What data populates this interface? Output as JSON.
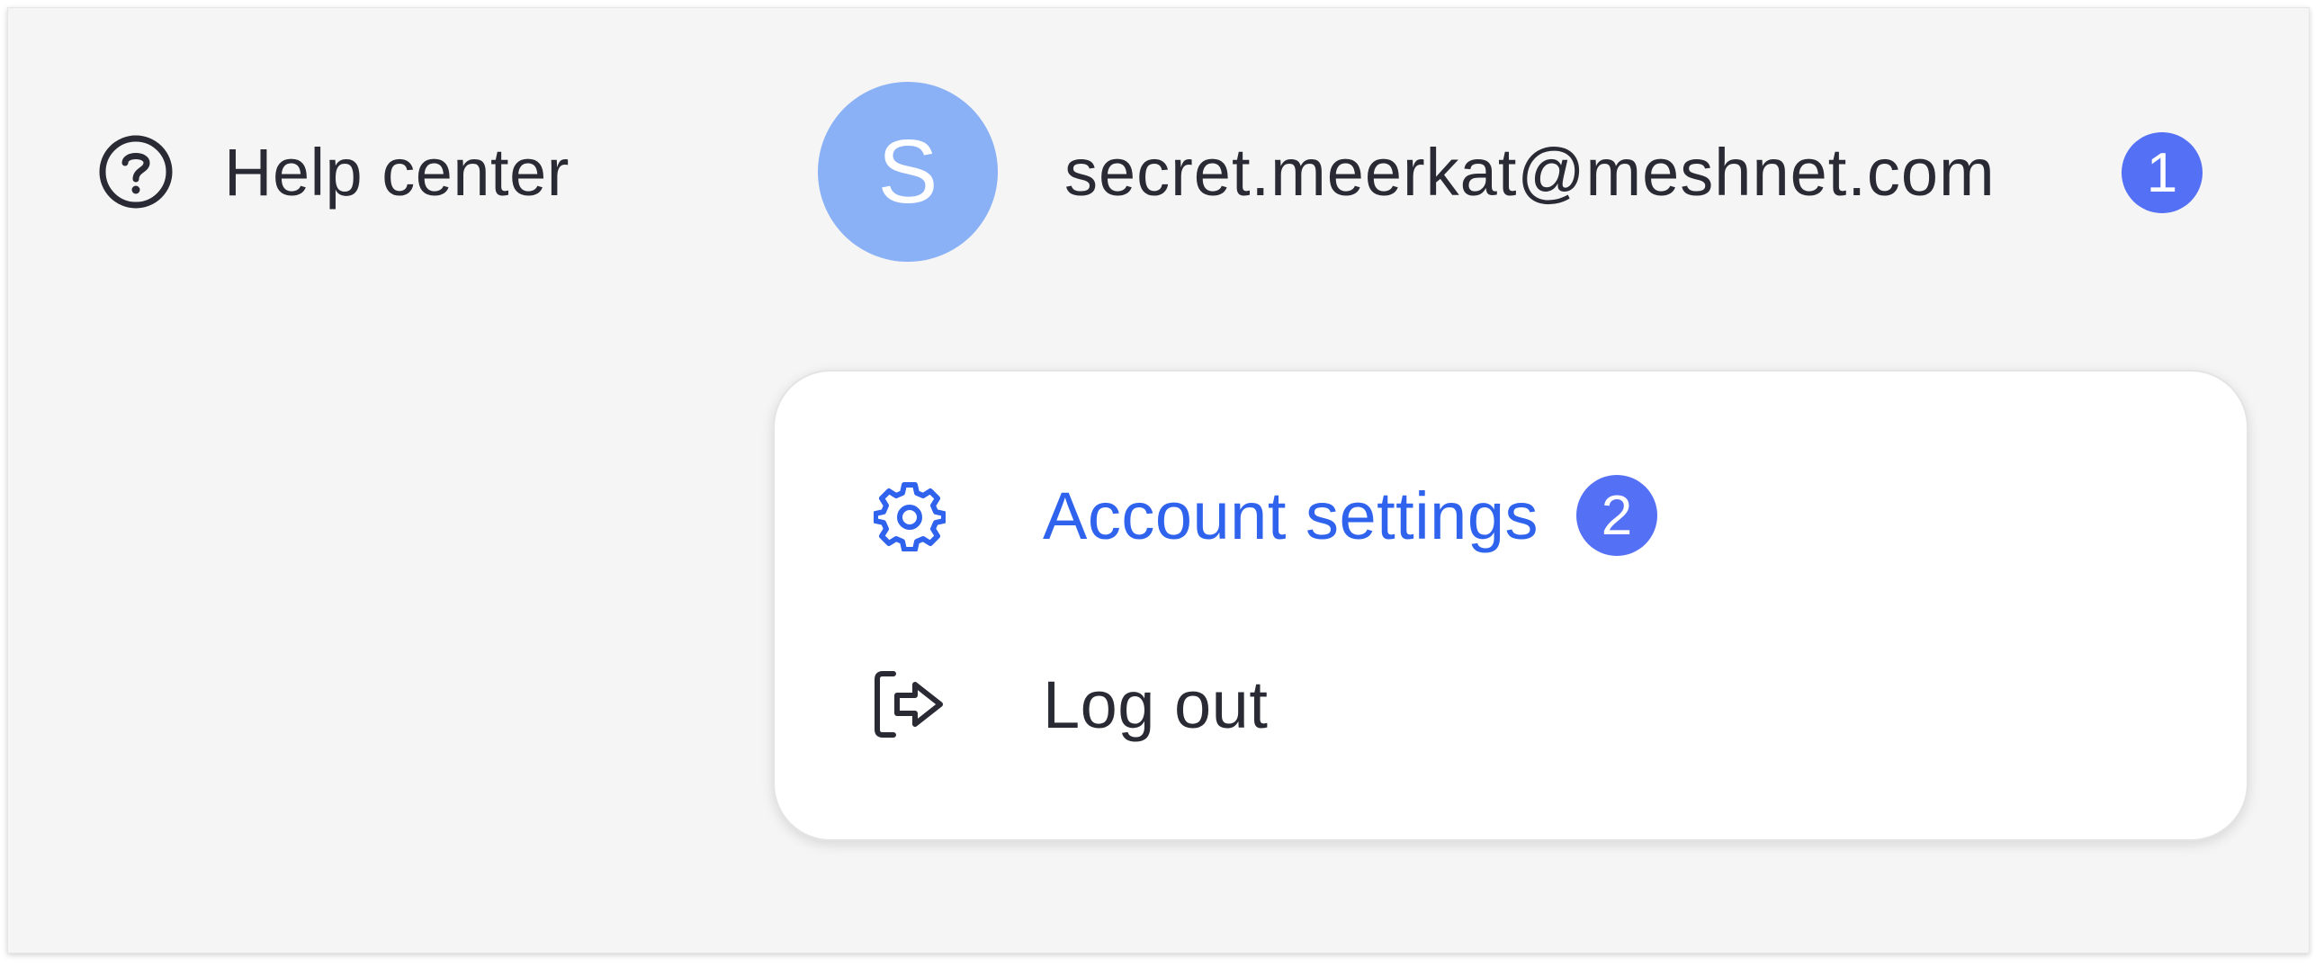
{
  "header": {
    "help": {
      "label": "Help center",
      "icon": "question-circle-icon"
    },
    "account": {
      "avatar_initial": "S",
      "email": "secret.meerkat@meshnet.com",
      "badge": "1"
    }
  },
  "menu": {
    "items": [
      {
        "label": "Account settings",
        "icon": "gear-icon",
        "badge": "2",
        "color": "#2f63ee"
      },
      {
        "label": "Log out",
        "icon": "logout-icon",
        "color": "#2a2a35"
      }
    ]
  },
  "colors": {
    "panel_bg": "#f5f5f5",
    "avatar_bg": "#8ab0f6",
    "badge_bg": "#5470f5",
    "accent": "#2f63ee",
    "text": "#2a2a35"
  }
}
